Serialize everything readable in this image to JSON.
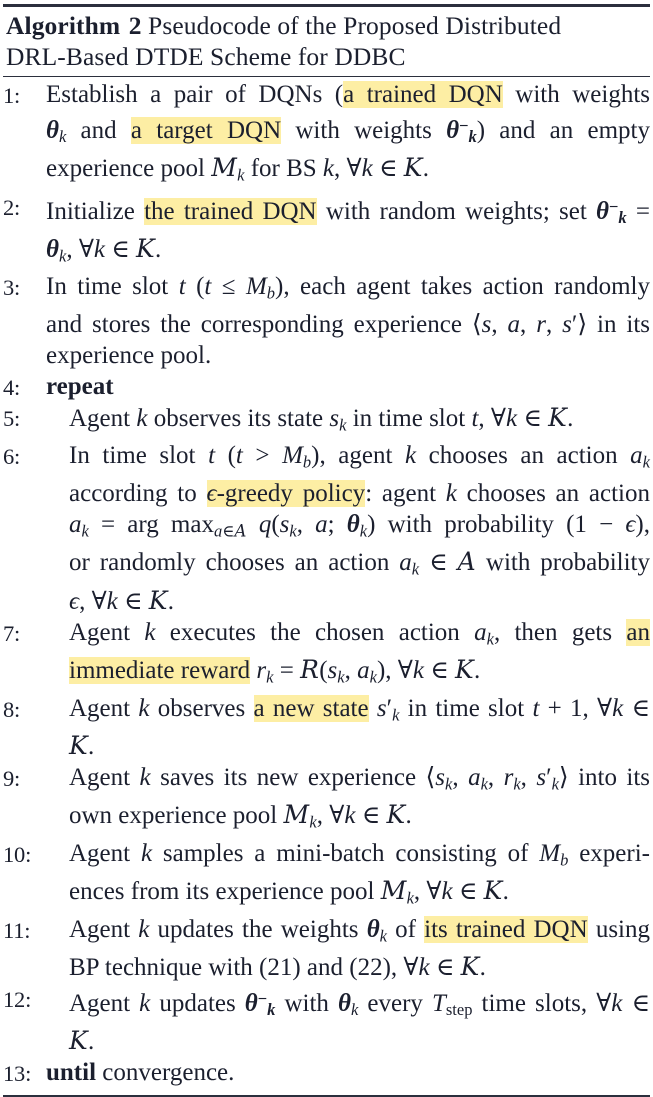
{
  "document": {
    "kind": "algorithm-block",
    "highlight_color": "#fdeea4",
    "text_color": "#1b1f2e",
    "rule_color": "#2b2f3d"
  },
  "title": {
    "keyword": "Algorithm",
    "number": "2",
    "line1_rest": "Pseudocode of the Proposed Distributed",
    "line2": "DRL-Based DTDE Scheme for DDBC",
    "full": "Algorithm 2 Pseudocode of the Proposed Distributed DRL-Based DTDE Scheme for DDBC"
  },
  "steps": [
    {
      "number": "1:",
      "indent": false,
      "text": "Establish a pair of DQNs (a trained DQN with weights θ_k and a target DQN with weights θ_k^-) and an empty experience pool M_k for BS k, ∀k ∈ K.",
      "highlights": [
        "a trained DQN",
        "a target DQN"
      ],
      "lines": [
        "Establish a pair of DQNs (a trained DQN with weights",
        "θ_k and a target DQN with weights θ_k^-) and an empty",
        "experience pool M_k for BS k, ∀k ∈ K."
      ]
    },
    {
      "number": "2:",
      "indent": false,
      "text": "Initialize the trained DQN with random weights; set θ_k^- = θ_k, ∀k ∈ K.",
      "highlights": [
        "the trained DQN"
      ],
      "lines": [
        "Initialize the trained DQN with random weights; set θ_k^- =",
        "θ_k, ∀k ∈ K."
      ]
    },
    {
      "number": "3:",
      "indent": false,
      "text": "In time slot t (t ≤ M_b), each agent takes action randomly and stores the corresponding experience ⟨s, a, r, s′⟩ in its experience pool.",
      "highlights": [],
      "lines": [
        "In time slot t (t ≤ M_b), each agent takes action randomly",
        "and stores the corresponding experience ⟨s, a, r, s′⟩ in its",
        "experience pool."
      ]
    },
    {
      "number": "4:",
      "indent": false,
      "text": "repeat",
      "keyword": "repeat",
      "highlights": [],
      "lines": [
        "repeat"
      ]
    },
    {
      "number": "5:",
      "indent": true,
      "text": "Agent k observes its state s_k in time slot t, ∀k ∈ K.",
      "highlights": [],
      "lines": [
        "Agent k observes its state s_k in time slot t, ∀k ∈ K."
      ]
    },
    {
      "number": "6:",
      "indent": true,
      "text": "In time slot t (t > M_b), agent k chooses an action a_k according to ε-greedy policy: agent k chooses an action a_k = arg max_{a∈A} q(s_k, a; θ_k) with probability (1 − ε), or randomly chooses an action a_k ∈ A with probability ε, ∀k ∈ K.",
      "highlights": [
        "ϵ-greedy policy"
      ],
      "lines": [
        "In time slot t (t > M_b), agent k chooses an action a_k",
        "according to ϵ-greedy policy: agent k chooses an action",
        "a_k = arg max_{a∈A} q(s_k, a; θ_k) with probability (1 − ϵ),",
        "or randomly chooses an action a_k ∈ A with probability",
        "ϵ, ∀k ∈ K."
      ]
    },
    {
      "number": "7:",
      "indent": true,
      "text": "Agent k executes the chosen action a_k, then gets an immediate reward r_k = R(s_k, a_k), ∀k ∈ K.",
      "highlights": [
        "an immediate reward"
      ],
      "lines": [
        "Agent k executes the chosen action a_k, then gets an",
        "immediate reward r_k = R(s_k, a_k), ∀k ∈ K."
      ]
    },
    {
      "number": "8:",
      "indent": true,
      "text": "Agent k observes a new state s′_k in time slot t + 1, ∀k ∈ K.",
      "highlights": [
        "a new state"
      ],
      "lines": [
        "Agent k observes a new state s′_k in time slot t + 1, ∀k ∈",
        "K."
      ]
    },
    {
      "number": "9:",
      "indent": true,
      "text": "Agent k saves its new experience ⟨s_k, a_k, r_k, s′_k⟩ into its own experience pool M_k, ∀k ∈ K.",
      "highlights": [],
      "lines": [
        "Agent k saves its new experience ⟨s_k, a_k, r_k, s′_k⟩ into its",
        "own experience pool M_k, ∀k ∈ K."
      ]
    },
    {
      "number": "10:",
      "indent": true,
      "text": "Agent k samples a mini-batch consisting of M_b experiences from its experience pool M_k, ∀k ∈ K.",
      "highlights": [],
      "lines": [
        "Agent k samples a mini-batch consisting of M_b experi-",
        "ences from its experience pool M_k, ∀k ∈ K."
      ]
    },
    {
      "number": "11:",
      "indent": true,
      "text": "Agent k updates the weights θ_k of its trained DQN using BP technique with (21) and (22), ∀k ∈ K.",
      "highlights": [
        "its trained DQN"
      ],
      "lines": [
        "Agent k updates the weights θ_k of its trained DQN using",
        "BP technique with (21) and (22), ∀k ∈ K."
      ]
    },
    {
      "number": "12:",
      "indent": true,
      "text": "Agent k updates θ_k^- with θ_k every T_step time slots, ∀k ∈ K.",
      "highlights": [],
      "lines": [
        "Agent k updates θ_k^- with θ_k every T_step time slots, ∀k ∈",
        "K."
      ]
    },
    {
      "number": "13:",
      "indent": false,
      "text": "until convergence.",
      "keyword": "until",
      "rest": "convergence.",
      "highlights": [],
      "lines": [
        "until convergence."
      ]
    }
  ]
}
